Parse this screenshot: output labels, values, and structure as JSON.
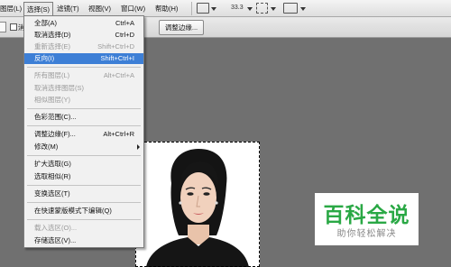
{
  "menubar": {
    "items": [
      "图层(L)",
      "选择(S)",
      "滤镜(T)",
      "视图(V)",
      "窗口(W)",
      "帮助(H)"
    ],
    "zoom": "33.3"
  },
  "options": {
    "checkbox_label": "消",
    "refine_edge_button": "调整边缘..."
  },
  "select_menu": {
    "all": {
      "label": "全部(A)",
      "shortcut": "Ctrl+A"
    },
    "deselect": {
      "label": "取消选择(D)",
      "shortcut": "Ctrl+D"
    },
    "reselect": {
      "label": "重新选择(E)",
      "shortcut": "Shift+Ctrl+D"
    },
    "inverse": {
      "label": "反向(I)",
      "shortcut": "Shift+Ctrl+I"
    },
    "all_layers": {
      "label": "所有图层(L)",
      "shortcut": "Alt+Ctrl+A"
    },
    "deselect_layers": {
      "label": "取消选择图层(S)"
    },
    "similar_layers": {
      "label": "相似图层(Y)"
    },
    "color_range": {
      "label": "色彩范围(C)..."
    },
    "refine_edge": {
      "label": "调整边缘(F)...",
      "shortcut": "Alt+Ctrl+R"
    },
    "modify": {
      "label": "修改(M)"
    },
    "grow": {
      "label": "扩大选取(G)"
    },
    "similar": {
      "label": "选取相似(R)"
    },
    "transform": {
      "label": "变换选区(T)"
    },
    "quick_mask": {
      "label": "在快速蒙版模式下编辑(Q)"
    },
    "load": {
      "label": "载入选区(O)..."
    },
    "save": {
      "label": "存储选区(V)..."
    }
  },
  "watermark": {
    "title": "百科全说",
    "subtitle": "助你轻松解决"
  },
  "colors": {
    "highlight": "#3d7fd6",
    "watermark_green": "#2aa845"
  }
}
